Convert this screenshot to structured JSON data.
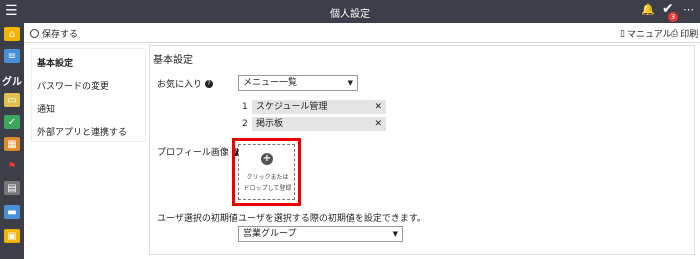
{
  "topbar": {
    "menu_icon": "☰",
    "title": "個人設定",
    "bell_icon": "🔔",
    "check_icon": "✔",
    "badge": "3",
    "more_icon": "⋯"
  },
  "leftnav": {
    "partial_label": "グル"
  },
  "toolbar": {
    "save": "保存する",
    "manual": "マニュアル",
    "print": "印刷"
  },
  "menu": {
    "items": [
      "基本設定",
      "パスワードの変更",
      "通知",
      "外部アプリと連携する"
    ]
  },
  "main": {
    "section_title": "基本設定",
    "favorites": {
      "label": "お気に入り",
      "help": "?",
      "selected": "メニュー一覧",
      "items": [
        {
          "num": "1",
          "name": "スケジュール管理"
        },
        {
          "num": "2",
          "name": "掲示板"
        }
      ]
    },
    "profile": {
      "label": "プロフィール画像",
      "help": "?",
      "drop_line1": "クリックまたは",
      "drop_line2": "ドロップして登録"
    },
    "user_select": {
      "label": "ユーザ選択の初期値",
      "description": "ユーザを選択する際の初期値を設定できます。",
      "selected": "営業グループ"
    }
  },
  "colors": {
    "header_bg": "#3c3f4a",
    "highlight": "#e00000",
    "badge": "#e53935"
  }
}
